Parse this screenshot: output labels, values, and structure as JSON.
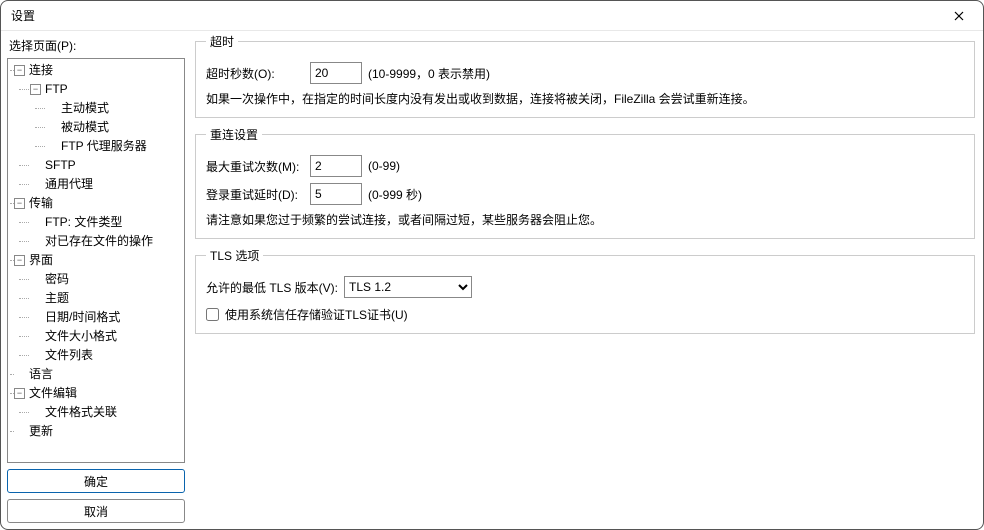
{
  "window": {
    "title": "设置"
  },
  "sidebar": {
    "label": "选择页面(P):",
    "ok": "确定",
    "cancel": "取消",
    "tree": [
      {
        "label": "连接",
        "level": 0,
        "expandable": true,
        "children": [
          {
            "label": "FTP",
            "level": 1,
            "expandable": true,
            "children": [
              {
                "label": "主动模式",
                "level": 2
              },
              {
                "label": "被动模式",
                "level": 2
              },
              {
                "label": "FTP 代理服务器",
                "level": 2
              }
            ]
          },
          {
            "label": "SFTP",
            "level": 1
          },
          {
            "label": "通用代理",
            "level": 1
          }
        ]
      },
      {
        "label": "传输",
        "level": 0,
        "expandable": true,
        "children": [
          {
            "label": "FTP: 文件类型",
            "level": 1
          },
          {
            "label": "对已存在文件的操作",
            "level": 1
          }
        ]
      },
      {
        "label": "界面",
        "level": 0,
        "expandable": true,
        "children": [
          {
            "label": "密码",
            "level": 1
          },
          {
            "label": "主题",
            "level": 1
          },
          {
            "label": "日期/时间格式",
            "level": 1
          },
          {
            "label": "文件大小格式",
            "level": 1
          },
          {
            "label": "文件列表",
            "level": 1
          }
        ]
      },
      {
        "label": "语言",
        "level": 0
      },
      {
        "label": "文件编辑",
        "level": 0,
        "expandable": true,
        "children": [
          {
            "label": "文件格式关联",
            "level": 1
          }
        ]
      },
      {
        "label": "更新",
        "level": 0
      }
    ]
  },
  "main": {
    "timeout": {
      "legend": "超时",
      "label": "超时秒数(O):",
      "value": "20",
      "hint": "(10-9999，0 表示禁用)",
      "note": "如果一次操作中，在指定的时间长度内没有发出或收到数据，连接将被关闭，FileZilla 会尝试重新连接。"
    },
    "reconnect": {
      "legend": "重连设置",
      "max_label": "最大重试次数(M):",
      "max_value": "2",
      "max_hint": "(0-99)",
      "delay_label": "登录重试延时(D):",
      "delay_value": "5",
      "delay_hint": "(0-999 秒)",
      "note": "请注意如果您过于频繁的尝试连接，或者间隔过短，某些服务器会阻止您。"
    },
    "tls": {
      "legend": "TLS 选项",
      "min_label": "允许的最低 TLS 版本(V):",
      "min_value": "TLS 1.2",
      "trust_label": "使用系统信任存储验证TLS证书(U)"
    }
  }
}
